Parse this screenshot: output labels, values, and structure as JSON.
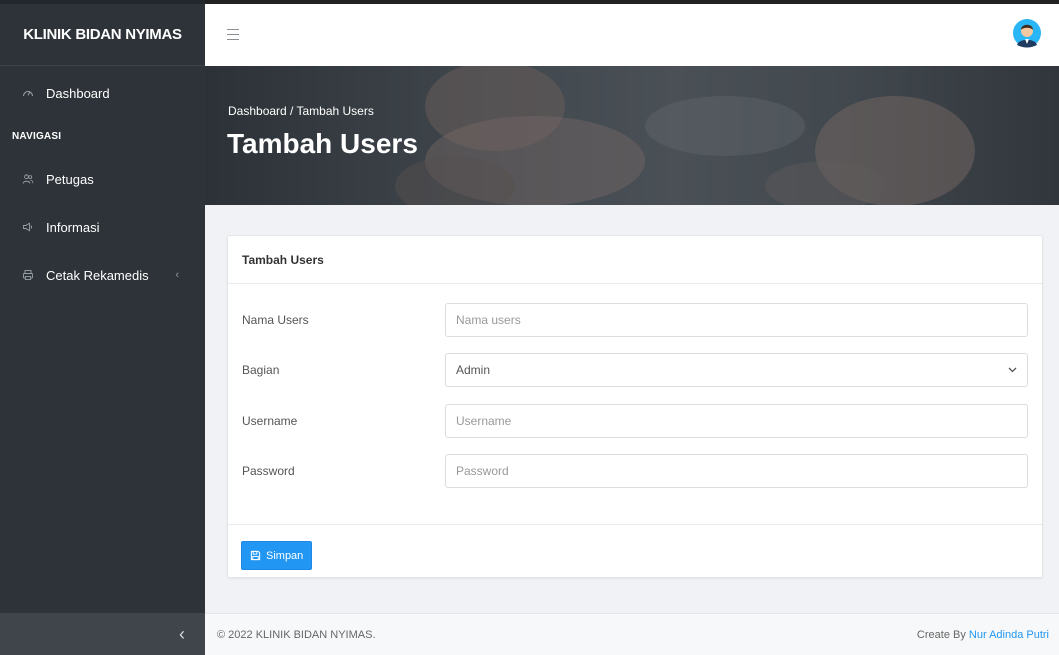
{
  "brand": "KLINIK BIDAN NYIMAS",
  "sidebar": {
    "items": [
      {
        "label": "Dashboard",
        "icon": "dashboard-icon"
      },
      {
        "label": "Petugas",
        "icon": "users-icon"
      },
      {
        "label": "Informasi",
        "icon": "megaphone-icon"
      },
      {
        "label": "Cetak Rekamedis",
        "icon": "printer-icon"
      }
    ],
    "section_header": "NAVIGASI",
    "chevron": "‹",
    "collapse_icon": "‹"
  },
  "hero": {
    "breadcrumb": "Dashboard / Tambah Users",
    "title": "Tambah Users"
  },
  "card": {
    "title": "Tambah Users",
    "fields": [
      {
        "label": "Nama Users",
        "placeholder": "Nama users"
      },
      {
        "label": "Bagian",
        "value": "Admin"
      },
      {
        "label": "Username",
        "placeholder": "Username"
      },
      {
        "label": "Password",
        "placeholder": "Password"
      }
    ],
    "submit_label": "Simpan"
  },
  "footer": {
    "copyright": "© 2022 KLINIK BIDAN NYIMAS.",
    "credit_prefix": "Create By ",
    "credit_name": "Nur Adinda Putri"
  },
  "colors": {
    "sidebar": "#2d3339",
    "accent": "#2196f3"
  }
}
